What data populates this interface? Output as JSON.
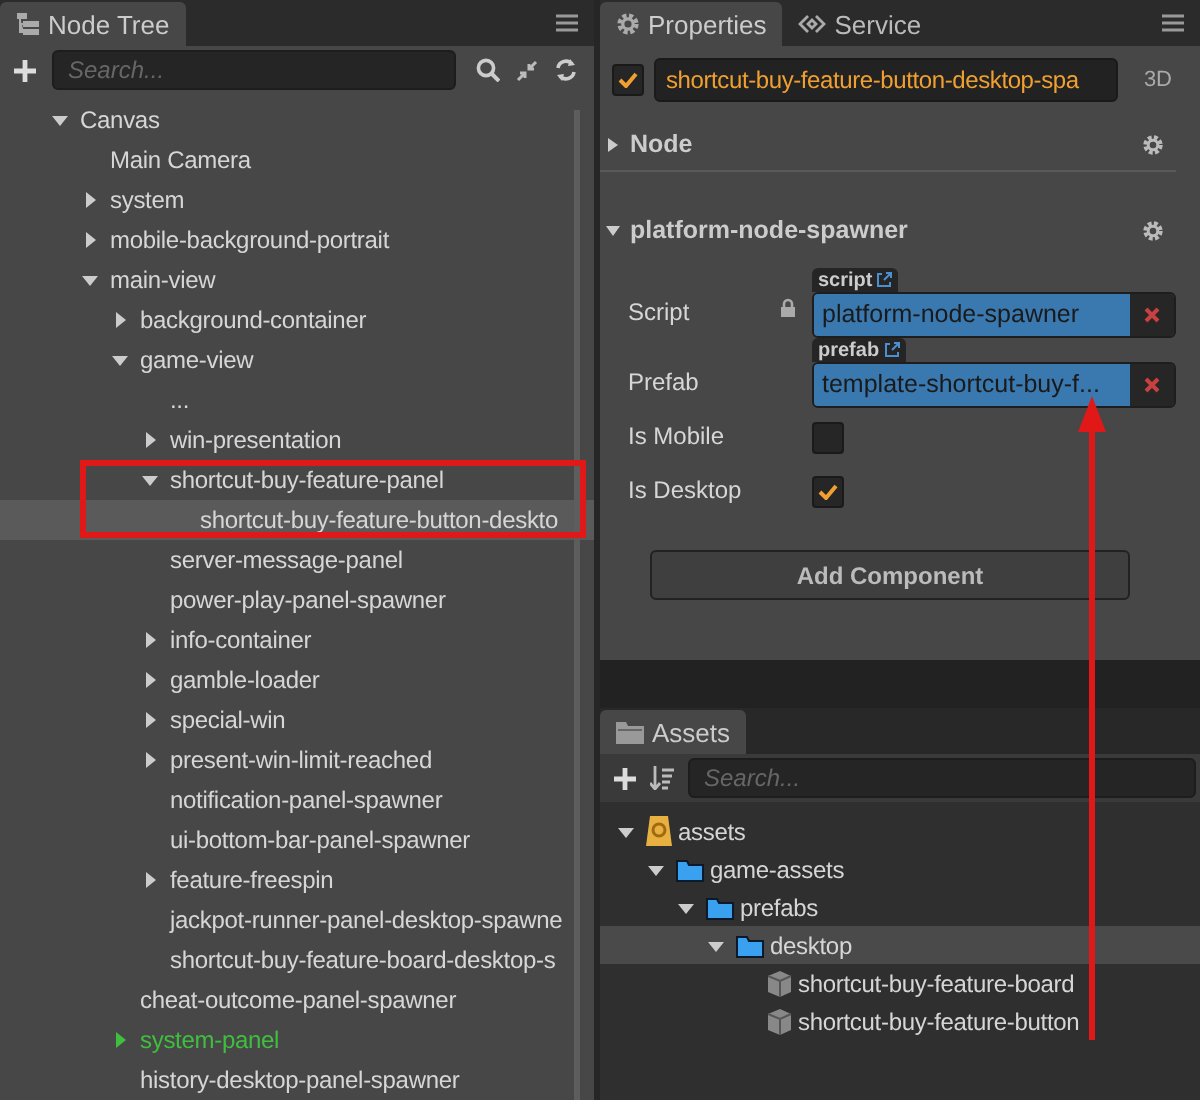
{
  "node_tree": {
    "tab": "Node Tree",
    "search": {
      "placeholder": "Search..."
    },
    "nodes": [
      {
        "label": "Canvas",
        "expanded": true,
        "selected": false,
        "children": [
          {
            "label": "Main Camera",
            "selected": false
          },
          {
            "label": "system",
            "expanded": false,
            "selected": false
          },
          {
            "label": "mobile-background-portrait",
            "expanded": false,
            "selected": false
          },
          {
            "label": "main-view",
            "expanded": true,
            "selected": false,
            "children": [
              {
                "label": "background-container",
                "expanded": false,
                "selected": false
              },
              {
                "label": "game-view",
                "expanded": true,
                "selected": false,
                "children": [
                  {
                    "label": "...",
                    "selected": false
                  },
                  {
                    "label": "win-presentation",
                    "expanded": false,
                    "selected": false
                  },
                  {
                    "label": "shortcut-buy-feature-panel",
                    "expanded": true,
                    "selected": false,
                    "children": [
                      {
                        "label": "shortcut-buy-feature-button-deskto",
                        "selected": true
                      }
                    ]
                  },
                  {
                    "label": "server-message-panel",
                    "selected": false
                  },
                  {
                    "label": "power-play-panel-spawner",
                    "selected": false
                  },
                  {
                    "label": "info-container",
                    "expanded": false,
                    "selected": false
                  },
                  {
                    "label": "gamble-loader",
                    "expanded": false,
                    "selected": false
                  },
                  {
                    "label": "special-win",
                    "expanded": false,
                    "selected": false
                  },
                  {
                    "label": "present-win-limit-reached",
                    "expanded": false,
                    "selected": false
                  },
                  {
                    "label": "notification-panel-spawner",
                    "selected": false
                  },
                  {
                    "label": "ui-bottom-bar-panel-spawner",
                    "selected": false
                  },
                  {
                    "label": "feature-freespin",
                    "expanded": false,
                    "selected": false
                  },
                  {
                    "label": "jackpot-runner-panel-desktop-spawne",
                    "selected": false
                  },
                  {
                    "label": "shortcut-buy-feature-board-desktop-s",
                    "selected": false
                  }
                ]
              },
              {
                "label": "cheat-outcome-panel-spawner",
                "selected": false
              },
              {
                "label": "system-panel",
                "expanded": false,
                "selected": false,
                "color": "#3fbf3f"
              },
              {
                "label": "history-desktop-panel-spawner",
                "selected": false
              }
            ]
          }
        ]
      }
    ]
  },
  "properties": {
    "tabs": [
      {
        "label": "Properties",
        "selected": true
      },
      {
        "label": "Service",
        "selected": false
      }
    ],
    "node_active": true,
    "node_name": "shortcut-buy-feature-button-desktop-spa",
    "mode": "3D",
    "sections": [
      {
        "title": "Node",
        "expanded": false
      },
      {
        "title": "platform-node-spawner",
        "expanded": true
      }
    ],
    "fields": [
      {
        "kind": "asset",
        "label": "Script",
        "tag": "script",
        "value": "platform-node-spawner",
        "locked": true
      },
      {
        "kind": "asset",
        "label": "Prefab",
        "tag": "prefab",
        "value": "template-shortcut-buy-f...",
        "locked": false
      },
      {
        "kind": "checkbox",
        "label": "Is Mobile",
        "checked": false
      },
      {
        "kind": "checkbox",
        "label": "Is Desktop",
        "checked": true
      }
    ],
    "add_button": "Add Component"
  },
  "assets": {
    "tab": "Assets",
    "search": {
      "placeholder": "Search..."
    },
    "items": [
      {
        "label": "assets",
        "kind": "root",
        "expanded": true,
        "selected": false,
        "children": [
          {
            "label": "game-assets",
            "kind": "folder",
            "expanded": true,
            "selected": false,
            "children": [
              {
                "label": "prefabs",
                "kind": "folder",
                "expanded": true,
                "selected": false,
                "children": [
                  {
                    "label": "desktop",
                    "kind": "folder",
                    "expanded": true,
                    "selected": true,
                    "children": [
                      {
                        "label": "shortcut-buy-feature-board",
                        "kind": "prefab",
                        "selected": false
                      },
                      {
                        "label": "shortcut-buy-feature-button",
                        "kind": "prefab",
                        "selected": false
                      }
                    ]
                  }
                ]
              }
            ]
          }
        ]
      }
    ]
  }
}
